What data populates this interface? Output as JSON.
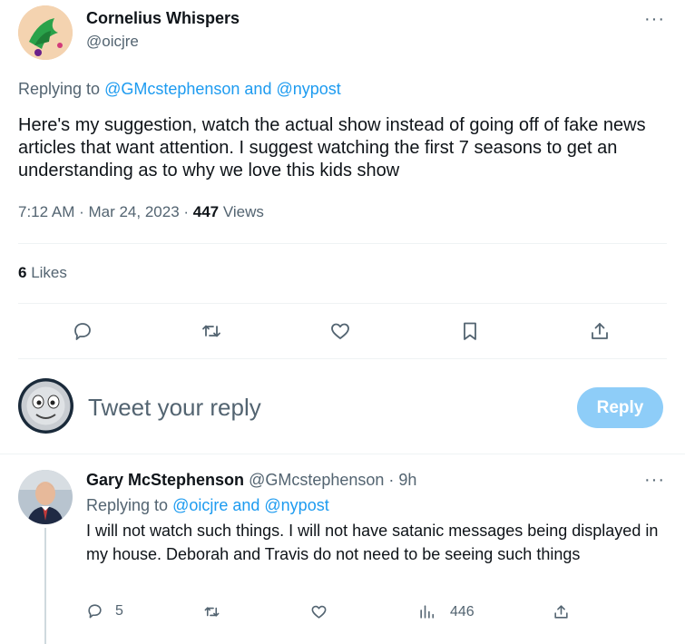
{
  "main_tweet": {
    "display_name": "Cornelius Whispers",
    "handle": "@oicjre",
    "replying_prefix": "Replying to",
    "replying_to": "@GMcstephenson and @nypost",
    "text": "Here's my suggestion, watch the actual show instead of going off of fake news articles that want attention. I suggest watching the first 7 seasons to get an understanding as to why we love this kids show",
    "time": "7:12 AM · Mar 24, 2023 · ",
    "views_count": "447",
    "views_label": " Views",
    "likes_count": "6",
    "likes_label": " Likes",
    "more_glyph": "···"
  },
  "composer": {
    "placeholder": "Tweet your reply",
    "reply_button": "Reply"
  },
  "reply_tweet": {
    "display_name": "Gary McStephenson",
    "handle_time": "@GMcstephenson · 9h",
    "replying_prefix": "Replying to",
    "replying_to": "@oicjre and @nypost",
    "text": "I will not watch such things. I will not have satanic messages being displayed in my house. Deborah and Travis do not need to be seeing such things",
    "reply_count": "5",
    "views_count": "446",
    "more_glyph": "···"
  },
  "colors": {
    "accent": "#1d9bf0",
    "reply_button_disabled": "#8ecdf8",
    "secondary_text": "#536471"
  },
  "icons": [
    "reply-icon",
    "retweet-icon",
    "like-icon",
    "bookmark-icon",
    "share-icon",
    "views-icon"
  ]
}
